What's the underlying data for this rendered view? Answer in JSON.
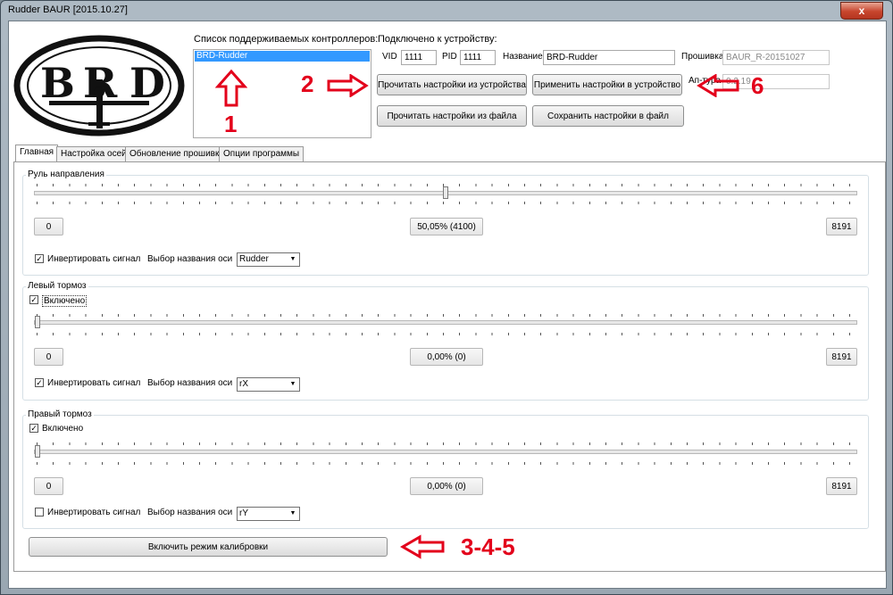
{
  "window": {
    "title": "Rudder BAUR [2015.10.27]",
    "close_glyph": "x"
  },
  "logo": {
    "text_left": "B",
    "text_mid": "R",
    "text_right": "D"
  },
  "controllers": {
    "heading": "Список поддерживаемых контроллеров:",
    "items": [
      "BRD-Rudder"
    ]
  },
  "device": {
    "heading": "Подключено к устройству:",
    "vid_label": "VID",
    "vid_value": "1111",
    "pid_label": "PID",
    "pid_value": "1111",
    "name_label": "Название",
    "name_value": "BRD-Rudder",
    "firmware_label": "Прошивка",
    "firmware_value": "BAUR_R-20151027",
    "hw_label": "Ап-тура",
    "hw_value": "0.2.19"
  },
  "buttons": {
    "read_device": "Прочитать настройки из устройства",
    "apply_device": "Применить настройки в устройство",
    "read_file": "Прочитать настройки из файла",
    "save_file": "Сохранить настройки в файл",
    "calibration": "Включить режим калибровки"
  },
  "tabs": [
    "Главная",
    "Настройка осей",
    "Обновление прошивки",
    "Опции программы"
  ],
  "groups": [
    {
      "title": "Руль направления",
      "slider_value": 0.5005,
      "min_label": "0",
      "center_label": "50,05% (4100)",
      "max_label": "8191",
      "invert_label": "Инвертировать сигнал",
      "invert_checked": true,
      "axis_label": "Выбор названия оси",
      "axis_value": "Rudder"
    },
    {
      "title": "Левый тормоз",
      "enabled_label": "Включено",
      "enabled_checked": true,
      "slider_value": 0,
      "min_label": "0",
      "center_label": "0,00% (0)",
      "max_label": "8191",
      "invert_label": "Инвертировать сигнал",
      "invert_checked": true,
      "axis_label": "Выбор названия оси",
      "axis_value": "rX"
    },
    {
      "title": "Правый тормоз",
      "enabled_label": "Включено",
      "enabled_checked": true,
      "slider_value": 0,
      "min_label": "0",
      "center_label": "0,00% (0)",
      "max_label": "8191",
      "invert_label": "Инвертировать сигнал",
      "invert_checked": false,
      "axis_label": "Выбор названия оси",
      "axis_value": "rY"
    }
  ],
  "annotations": {
    "n1": "1",
    "n2": "2",
    "n6": "6",
    "n345": "3-4-5"
  },
  "check_glyph": "✓",
  "colors": {
    "annotation": "#e3001b",
    "selection": "#3399ff"
  }
}
